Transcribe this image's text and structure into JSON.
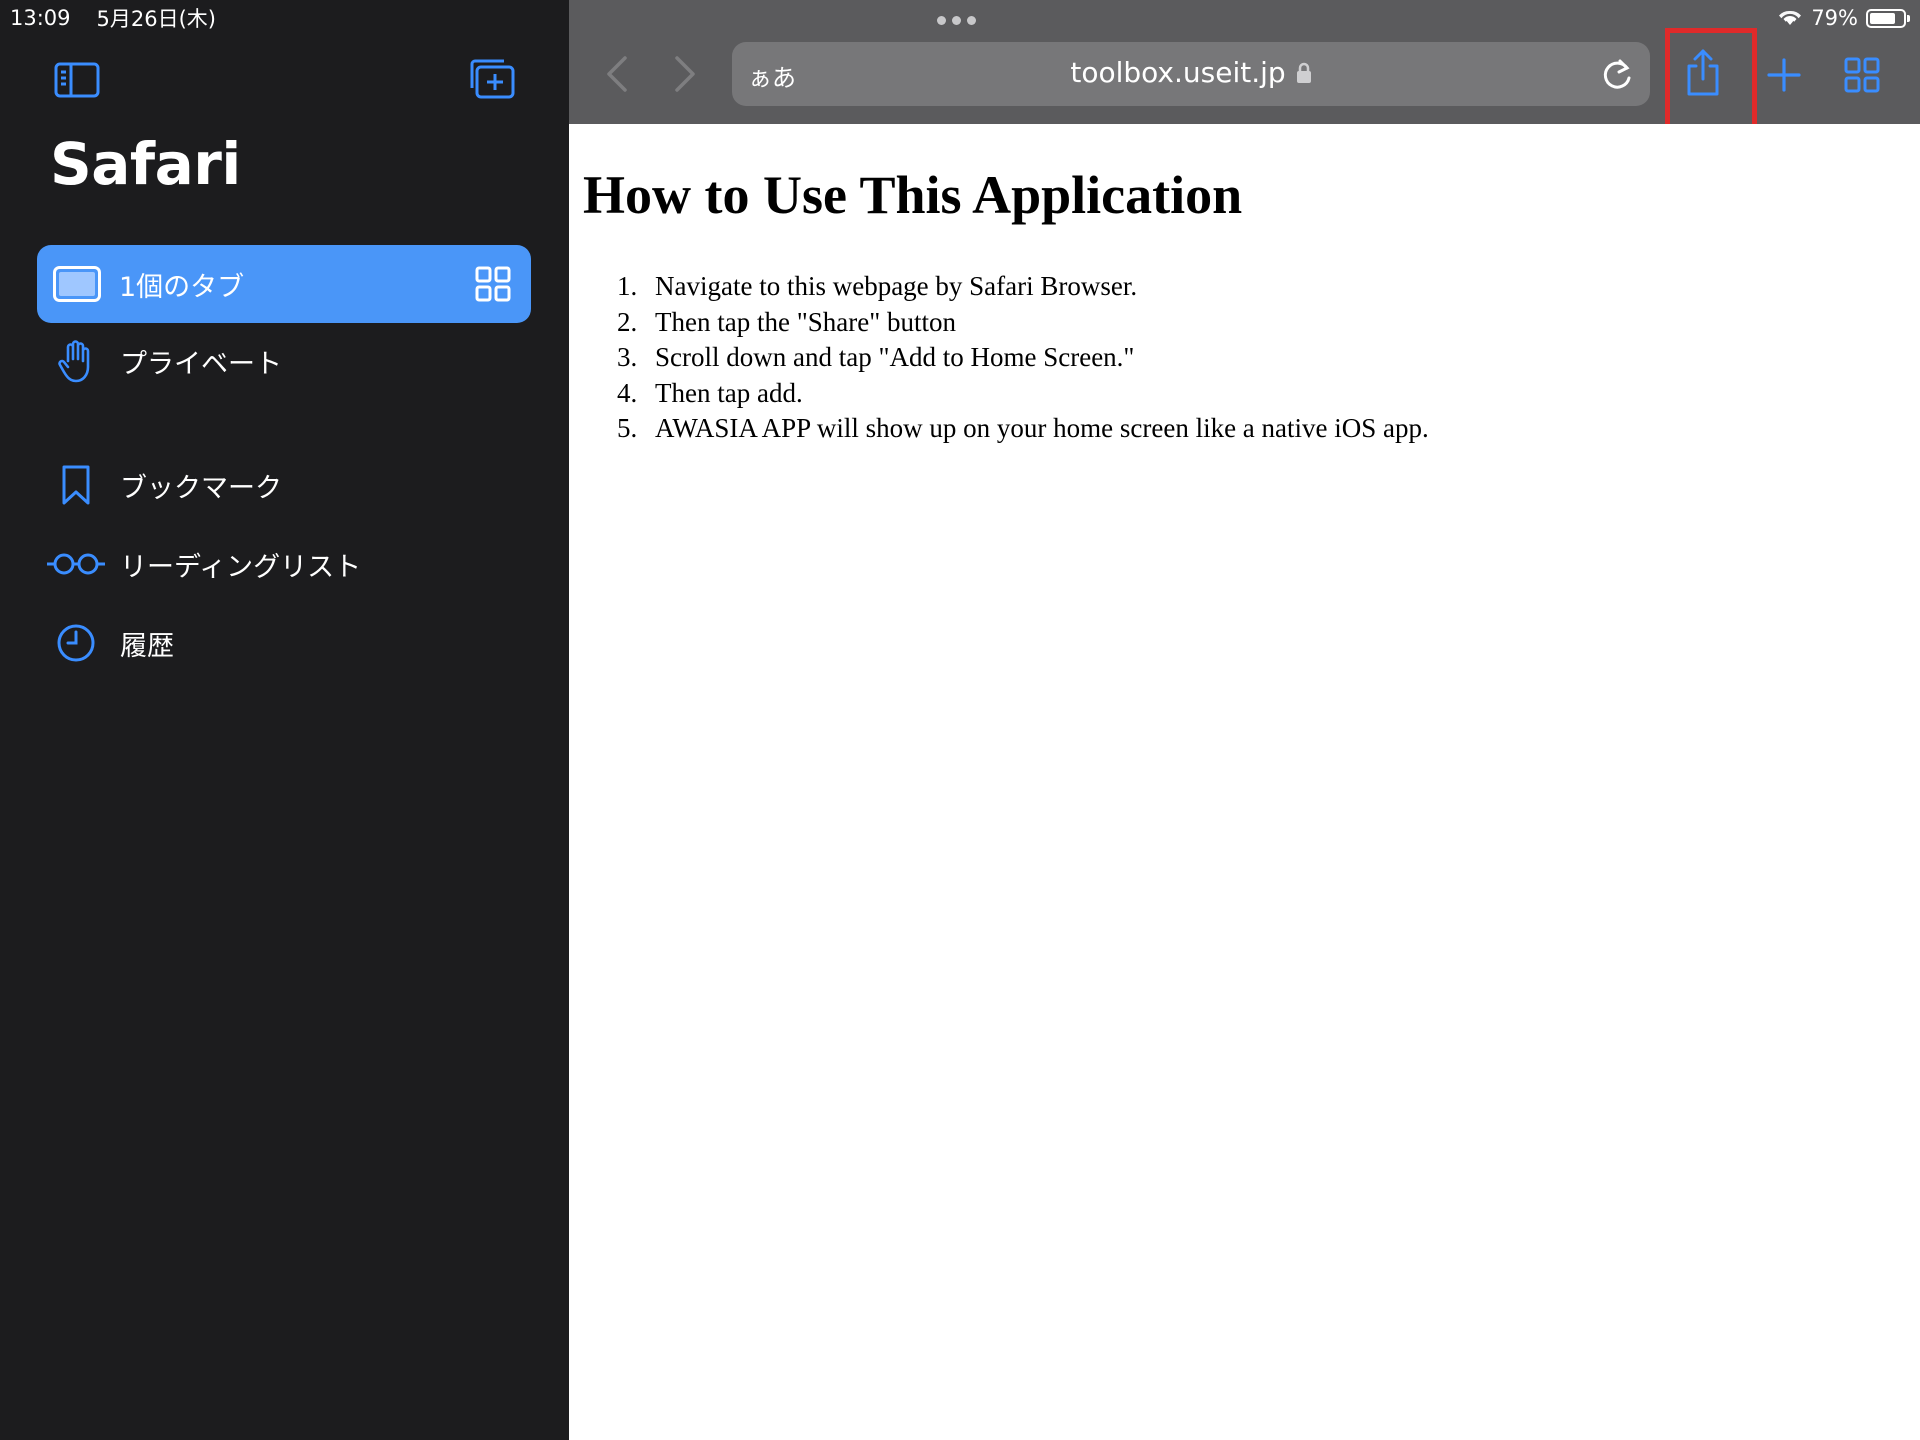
{
  "status_bar": {
    "time": "13:09",
    "date": "5月26日(木)",
    "battery_percent": "79%",
    "battery_level": 0.79
  },
  "sidebar": {
    "title": "Safari",
    "tabs_item": {
      "label": "1個のタブ",
      "icon": "ipad-icon",
      "trailing_icon": "tab-grid-icon"
    },
    "items": [
      {
        "label": "プライベート",
        "icon": "hand-icon"
      },
      {
        "label": "ブックマーク",
        "icon": "bookmark-icon"
      },
      {
        "label": "リーディングリスト",
        "icon": "glasses-icon"
      },
      {
        "label": "履歴",
        "icon": "clock-icon"
      }
    ],
    "icons": {
      "left": "sidebar-toggle-icon",
      "right": "new-tab-group-icon"
    }
  },
  "toolbar": {
    "reader_label": "ぁあ",
    "url": "toolbox.useit.jp",
    "icons": [
      "back-icon",
      "forward-icon",
      "lock-icon",
      "reload-icon",
      "share-icon",
      "plus-icon",
      "tab-overview-icon"
    ]
  },
  "colors": {
    "accent": "#3a8dff",
    "sidebar_bg": "#1c1c1e",
    "selected_row": "#4a96f8",
    "toolbar_bg": "#5b5b5d",
    "highlight": "#e02a2a"
  },
  "page": {
    "heading": "How to Use This Application",
    "steps": [
      {
        "num": "1.",
        "text": "Navigate to this webpage by Safari Browser."
      },
      {
        "num": "2.",
        "text": "Then tap the \"Share\" button"
      },
      {
        "num": "3.",
        "text": "Scroll down and tap \"Add to Home Screen.\""
      },
      {
        "num": "4.",
        "text": "Then tap add."
      },
      {
        "num": "5.",
        "text": "AWASIA APP will show up on your home screen like a native iOS app."
      }
    ]
  }
}
